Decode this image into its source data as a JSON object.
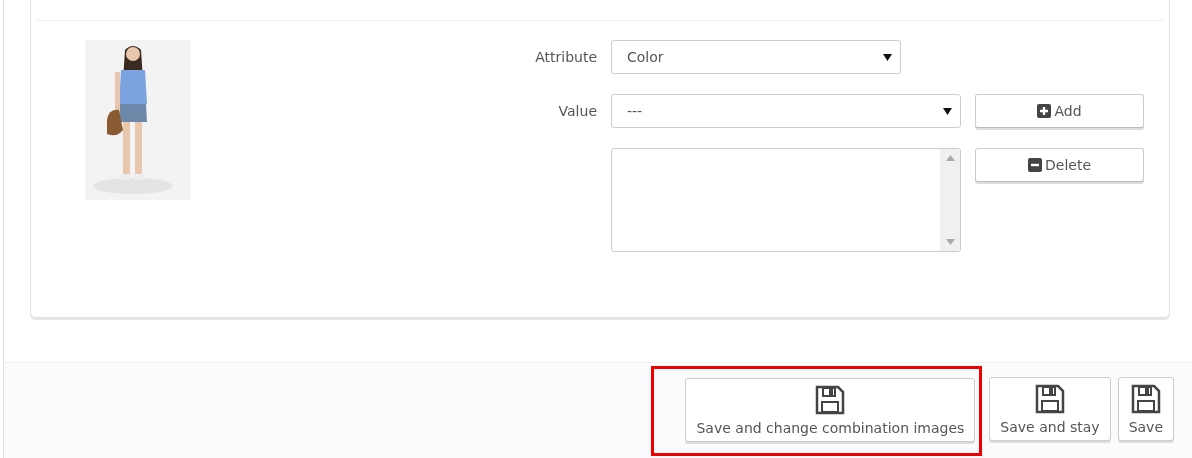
{
  "attribute": {
    "label": "Attribute",
    "value": "Color"
  },
  "value_field": {
    "label": "Value",
    "value": "---"
  },
  "list_buttons": [
    {
      "label": "Add",
      "kind": "add"
    },
    {
      "label": "Delete",
      "kind": "delete"
    }
  ],
  "footer_buttons": [
    {
      "label": "Save and change combination images",
      "highlighted": true
    },
    {
      "label": "Save and stay",
      "highlighted": false
    },
    {
      "label": "Save",
      "highlighted": false
    }
  ]
}
